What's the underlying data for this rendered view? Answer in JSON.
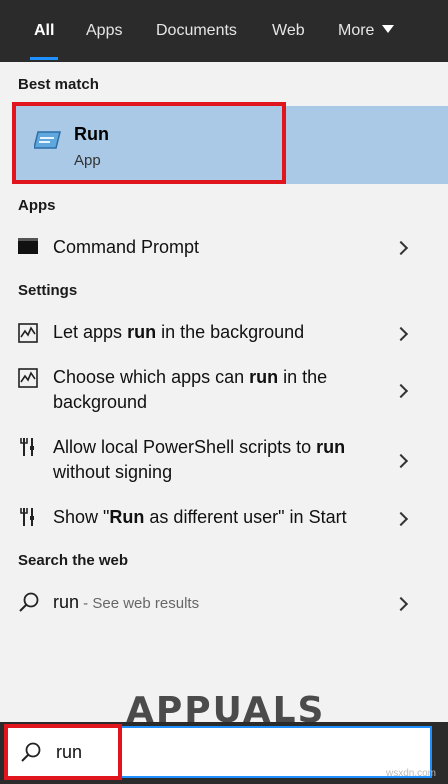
{
  "tabs": [
    {
      "label": "All",
      "active": true
    },
    {
      "label": "Apps"
    },
    {
      "label": "Documents"
    },
    {
      "label": "Web"
    },
    {
      "label": "More"
    }
  ],
  "best_match": {
    "section": "Best match",
    "title": "Run",
    "subtitle": "App",
    "icon": "run-app-icon"
  },
  "apps": {
    "section": "Apps",
    "items": [
      {
        "label": "Command Prompt",
        "icon": "command-prompt-icon"
      }
    ]
  },
  "settings": {
    "section": "Settings",
    "items": [
      {
        "pre": "Let apps ",
        "bold": "run",
        "post": " in the background",
        "icon": "settings-sliders-icon"
      },
      {
        "pre": "Choose which apps can ",
        "bold": "run",
        "post": " in the background",
        "icon": "settings-sliders-icon"
      },
      {
        "pre": "Allow local PowerShell scripts to ",
        "bold": "run",
        "post": " without signing",
        "icon": "settings-tools-icon"
      },
      {
        "pre": "Show \"",
        "bold": "Run",
        "post": " as different user\" in Start",
        "icon": "settings-tools-icon"
      }
    ]
  },
  "web": {
    "section": "Search the web",
    "query": "run",
    "hint": " - See web results",
    "icon": "search-icon"
  },
  "search": {
    "value": "run",
    "icon": "search-icon"
  },
  "watermark": "APPUALS",
  "credit": "wsxdn.com",
  "colors": {
    "accent": "#1e90ff",
    "selection": "#a9c9e6",
    "highlight_box": "#e0151d",
    "tabbar": "#2b2b2b"
  }
}
